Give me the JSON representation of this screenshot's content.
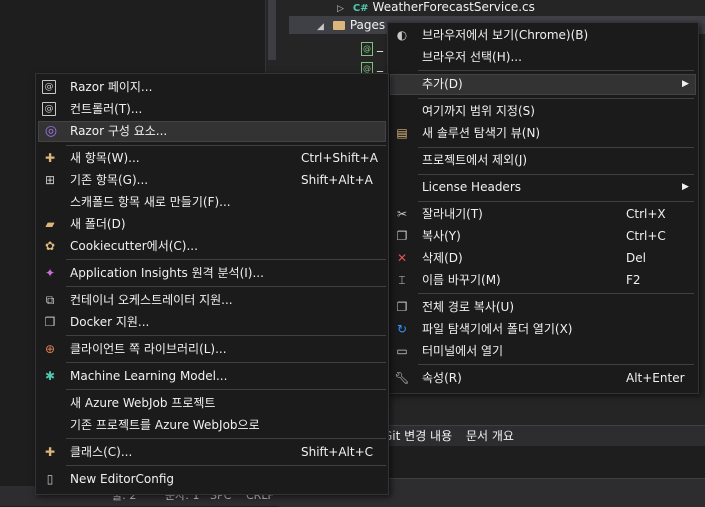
{
  "tree": {
    "file_weather": "WeatherForecastService.cs",
    "cs_badge": "C#",
    "folder_pages": "Pages",
    "razor_file_1": "_",
    "razor_file_2": "_"
  },
  "bottom_tabs": {
    "git_changes": "Git 변경 내용",
    "doc_outline": "문서 개요"
  },
  "status_left": {
    "line": "줄: 2",
    "char": "문자: 1",
    "spc": "SPC",
    "crlf": "CRLF"
  },
  "left_menu": {
    "items": [
      {
        "label": "Razor 페이지...",
        "shortcut": "",
        "icon": "razor-page-icon"
      },
      {
        "label": "컨트롤러(T)...",
        "shortcut": "",
        "icon": "controller-icon"
      },
      {
        "label": "Razor 구성 요소...",
        "shortcut": "",
        "icon": "razor-component-icon"
      },
      {
        "label": "새 항목(W)...",
        "shortcut": "Ctrl+Shift+A",
        "icon": "new-item-icon"
      },
      {
        "label": "기존 항목(G)...",
        "shortcut": "Shift+Alt+A",
        "icon": "existing-item-icon"
      },
      {
        "label": "스캐폴드 항목 새로 만들기(F)...",
        "shortcut": "",
        "icon": ""
      },
      {
        "label": "새 폴더(D)",
        "shortcut": "",
        "icon": "new-folder-icon"
      },
      {
        "label": "Cookiecutter에서(C)...",
        "shortcut": "",
        "icon": "cookiecutter-icon"
      },
      {
        "label": "Application Insights 원격 분석(I)...",
        "shortcut": "",
        "icon": "app-insights-icon"
      },
      {
        "label": "컨테이너 오케스트레이터 지원...",
        "shortcut": "",
        "icon": "container-icon"
      },
      {
        "label": "Docker 지원...",
        "shortcut": "",
        "icon": "docker-icon"
      },
      {
        "label": "클라이언트 쪽 라이브러리(L)...",
        "shortcut": "",
        "icon": "client-library-icon"
      },
      {
        "label": "Machine Learning Model...",
        "shortcut": "",
        "icon": "ml-model-icon"
      },
      {
        "label": "새 Azure WebJob 프로젝트",
        "shortcut": "",
        "icon": ""
      },
      {
        "label": "기존 프로젝트를 Azure WebJob으로",
        "shortcut": "",
        "icon": ""
      },
      {
        "label": "클래스(C)...",
        "shortcut": "Shift+Alt+C",
        "icon": "class-icon"
      },
      {
        "label": "New EditorConfig",
        "shortcut": "",
        "icon": "editorconfig-icon"
      }
    ]
  },
  "right_menu": {
    "items": [
      {
        "label": "브라우저에서 보기(Chrome)(B)",
        "shortcut": "",
        "icon": "browser-view-icon"
      },
      {
        "label": "브라우저 선택(H)...",
        "shortcut": "",
        "icon": ""
      },
      {
        "label": "추가(D)",
        "shortcut": "",
        "icon": ""
      },
      {
        "label": "여기까지 범위 지정(S)",
        "shortcut": "",
        "icon": ""
      },
      {
        "label": "새 솔루션 탐색기 뷰(N)",
        "shortcut": "",
        "icon": "new-explorer-view-icon"
      },
      {
        "label": "프로젝트에서 제외(J)",
        "shortcut": "",
        "icon": ""
      },
      {
        "label": "License Headers",
        "shortcut": "",
        "icon": ""
      },
      {
        "label": "잘라내기(T)",
        "shortcut": "Ctrl+X",
        "icon": "cut-icon"
      },
      {
        "label": "복사(Y)",
        "shortcut": "Ctrl+C",
        "icon": "copy-icon"
      },
      {
        "label": "삭제(D)",
        "shortcut": "Del",
        "icon": "delete-icon"
      },
      {
        "label": "이름 바꾸기(M)",
        "shortcut": "F2",
        "icon": "rename-icon"
      },
      {
        "label": "전체 경로 복사(U)",
        "shortcut": "",
        "icon": "copy-path-icon"
      },
      {
        "label": "파일 탐색기에서 폴더 열기(X)",
        "shortcut": "",
        "icon": "open-folder-icon"
      },
      {
        "label": "터미널에서 열기",
        "shortcut": "",
        "icon": "terminal-icon"
      },
      {
        "label": "속성(R)",
        "shortcut": "Alt+Enter",
        "icon": "properties-icon"
      }
    ]
  },
  "colors": {
    "menu_bg": "#1b1b1c",
    "highlight": "#333334",
    "text": "#f1f1f1",
    "razor_purple": "#a074e8",
    "delete_red": "#e05252"
  }
}
